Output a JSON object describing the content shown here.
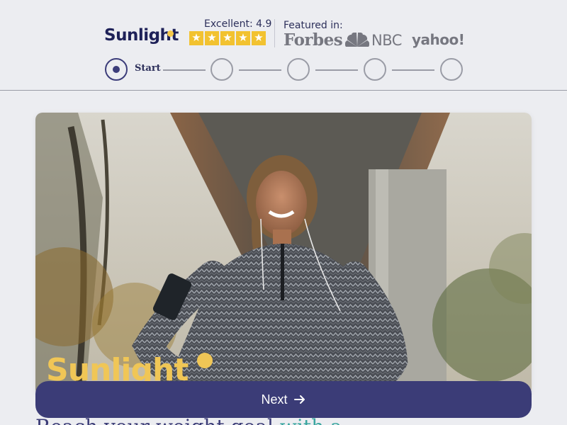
{
  "header": {
    "brand": "Sunlight",
    "rating_label": "Excellent: 4.9",
    "stars": [
      "★",
      "★",
      "★",
      "★",
      "★"
    ],
    "featured_label": "Featured in:",
    "logos": {
      "forbes": "Forbes",
      "nbc": "NBC",
      "yahoo": "yahoo!"
    }
  },
  "stepper": {
    "start_label": "Start",
    "total_steps": 5,
    "current_step": 1
  },
  "hero": {
    "brand_overlay": "Sunlight"
  },
  "next_button": {
    "label": "Next",
    "icon": "arrow-right-icon"
  },
  "headline": {
    "text": "Reach your weight goal ",
    "accent": "with a..."
  },
  "colors": {
    "brand_navy": "#1e2158",
    "accent_yellow": "#f5c84a",
    "button_bg": "#3b3c77",
    "star_bg": "#f2c230",
    "headline_accent": "#3aa6a0"
  }
}
